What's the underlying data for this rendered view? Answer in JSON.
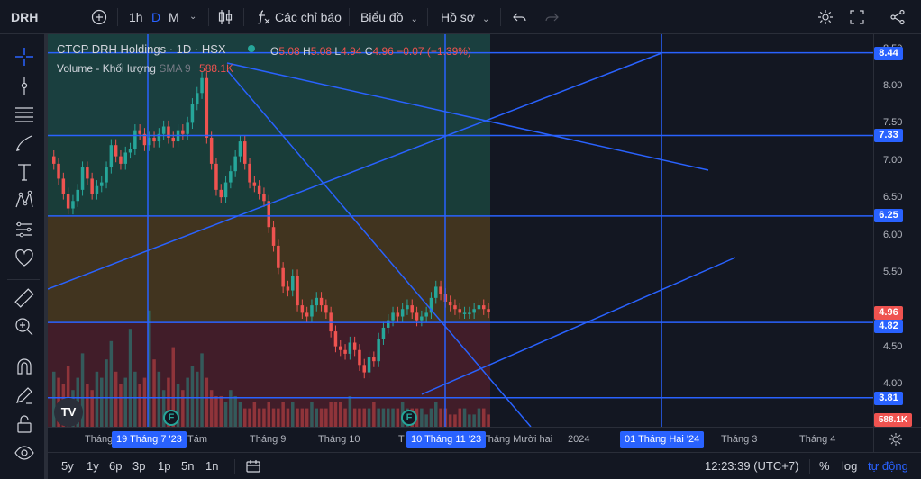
{
  "topbar": {
    "symbol": "DRH",
    "interval_1h": "1h",
    "interval_d": "D",
    "interval_m": "M",
    "indicators": "Các chỉ báo",
    "chart_type_menu": "Biểu đồ",
    "profile_menu": "Hồ sơ"
  },
  "legend": {
    "title": "CTCP DRH Holdings · 1D · HSX",
    "o_label": "O",
    "o_value": "5.08",
    "h_label": "H",
    "h_value": "5.08",
    "l_label": "L",
    "l_value": "4.94",
    "c_label": "C",
    "c_value": "4.96",
    "change": "−0.07 (−1.39%)",
    "volume_label": "Volume - Khối lượng",
    "sma_label": "SMA 9",
    "volume_value": "588.1K"
  },
  "price_scale": {
    "ticks": [
      "8.50",
      "8.00",
      "7.50",
      "7.00",
      "6.50",
      "6.00",
      "5.50",
      "4.50",
      "4.00"
    ],
    "badges": {
      "b844": "8.44",
      "b733": "7.33",
      "b625": "6.25",
      "b496": "4.96",
      "b482": "4.82",
      "b381": "3.81",
      "bvol": "588.1K"
    }
  },
  "time_scale": {
    "ticks": [
      "Tháng",
      "Tám",
      "Tháng 9",
      "Tháng 10",
      "T",
      "Tháng Mười hai",
      "2024",
      "Tháng 3",
      "Tháng 4"
    ],
    "badge_jul": "19 Tháng 7 '23",
    "badge_nov": "10 Tháng 11 '23",
    "badge_feb": "01 Tháng Hai '24"
  },
  "bottombar": {
    "range_5y": "5y",
    "range_1y": "1y",
    "range_6m": "6p",
    "range_3m": "3p",
    "range_1m": "1p",
    "range_5d": "5n",
    "range_1d": "1n",
    "clock": "12:23:39 (UTC+7)",
    "percent": "%",
    "log": "log",
    "auto": "tự động"
  },
  "chart_data": {
    "type": "candlestick",
    "symbol": "DRH",
    "ylim": [
      3.7,
      8.6
    ],
    "levels": [
      8.44,
      7.33,
      6.25,
      4.82,
      3.81
    ],
    "last_price": 4.96,
    "close_series": [
      6.95,
      6.75,
      6.55,
      6.35,
      6.45,
      6.6,
      6.9,
      6.75,
      6.55,
      6.65,
      6.7,
      6.9,
      7.2,
      7.05,
      6.95,
      7.1,
      7.15,
      7.4,
      7.35,
      7.2,
      7.3,
      7.25,
      7.35,
      7.45,
      7.3,
      7.25,
      7.4,
      7.35,
      7.5,
      7.75,
      7.9,
      8.1,
      7.3,
      6.95,
      6.6,
      6.5,
      6.7,
      6.85,
      7.05,
      7.25,
      6.95,
      6.7,
      6.65,
      6.55,
      6.45,
      6.1,
      5.85,
      5.55,
      5.3,
      5.25,
      5.45,
      5.05,
      4.95,
      4.9,
      5.05,
      5.15,
      5.05,
      4.95,
      4.7,
      4.5,
      4.45,
      4.4,
      4.55,
      4.45,
      4.25,
      4.15,
      4.35,
      4.3,
      4.6,
      4.75,
      4.85,
      4.95,
      4.9,
      5.0,
      5.05,
      4.95,
      4.85,
      4.9,
      4.95,
      5.15,
      5.3,
      5.2,
      5.1,
      5.05,
      5.0,
      4.95,
      4.95,
      4.95,
      5.0,
      5.05,
      5.0,
      4.96
    ],
    "volume_series": [
      0.9,
      0.8,
      0.7,
      1.0,
      0.6,
      0.8,
      1.2,
      0.7,
      0.6,
      0.9,
      0.8,
      1.1,
      1.4,
      0.9,
      0.7,
      0.8,
      1.6,
      0.9,
      0.7,
      0.8,
      1.9,
      1.1,
      0.9,
      0.6,
      0.8,
      1.3,
      0.7,
      0.6,
      0.8,
      1.0,
      0.9,
      1.2,
      0.8,
      0.6,
      0.5,
      0.5,
      0.4,
      0.6,
      0.5,
      0.4,
      0.3,
      0.3,
      0.4,
      0.3,
      0.3,
      0.4,
      0.3,
      0.3,
      0.4,
      0.3,
      0.4,
      0.3,
      0.3,
      0.3,
      0.4,
      0.3,
      0.3,
      0.3,
      0.4,
      0.4,
      0.4,
      0.3,
      0.5,
      0.3,
      0.3,
      0.3,
      0.3,
      0.4,
      0.3,
      0.3,
      0.3,
      0.3,
      0.3,
      0.4,
      0.3,
      0.3,
      0.3,
      0.3,
      0.2,
      0.3,
      0.4,
      0.3,
      0.3,
      0.2,
      0.2,
      0.3,
      0.3,
      0.2,
      0.2,
      0.3,
      0.3,
      0.2
    ],
    "colors": {
      "up": "#26a69a",
      "down": "#ef5350",
      "line": "#2962ff"
    }
  }
}
